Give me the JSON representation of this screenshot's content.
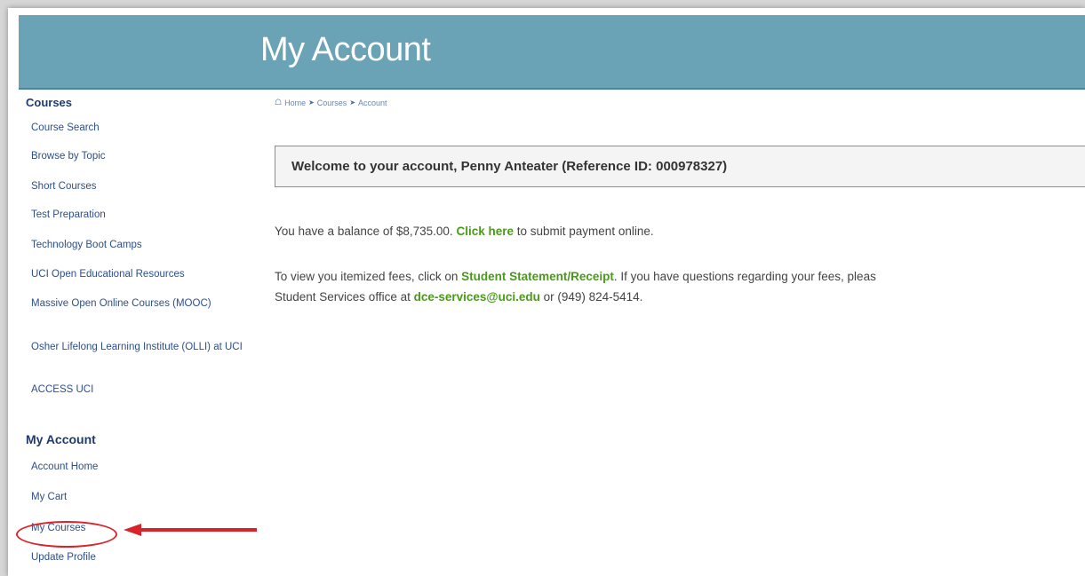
{
  "header": {
    "title": "My Account"
  },
  "breadcrumb": {
    "home": "Home",
    "courses": "Courses",
    "account": "Account"
  },
  "sidebar": {
    "courses_heading": "Courses",
    "courses_items": [
      {
        "label": "Course Search"
      },
      {
        "label": "Browse by Topic"
      },
      {
        "label": "Short Courses"
      },
      {
        "label": "Test Preparation"
      },
      {
        "label": "Technology Boot Camps"
      },
      {
        "label": "UCI Open Educational Resources"
      },
      {
        "label": "Massive Open Online Courses (MOOC)"
      },
      {
        "label": "Osher Lifelong Learning Institute (OLLI) at UCI"
      },
      {
        "label": "ACCESS UCI"
      }
    ],
    "account_heading": "My Account",
    "account_items": [
      {
        "label": "Account Home"
      },
      {
        "label": "My Cart"
      },
      {
        "label": "My Courses"
      },
      {
        "label": "Update Profile"
      }
    ]
  },
  "welcome": {
    "text": "Welcome to your account, Penny Anteater (Reference ID: 000978327)"
  },
  "balance": {
    "prefix": "You have a balance of $8,735.00.",
    "link": "Click here",
    "suffix": "to submit payment online."
  },
  "fees": {
    "prefix": "To view you itemized fees, click on",
    "link": "Student Statement/Receipt",
    "middle": ". If you have questions regarding your fees, pleas",
    "line2_prefix": "Student Services office at",
    "email": "dce-services@uci.edu",
    "line2_suffix": "or (949) 824-5414."
  },
  "colors": {
    "banner": "#6aa2b6",
    "link_green": "#4a9a1a",
    "highlight_red": "#d8232a"
  }
}
